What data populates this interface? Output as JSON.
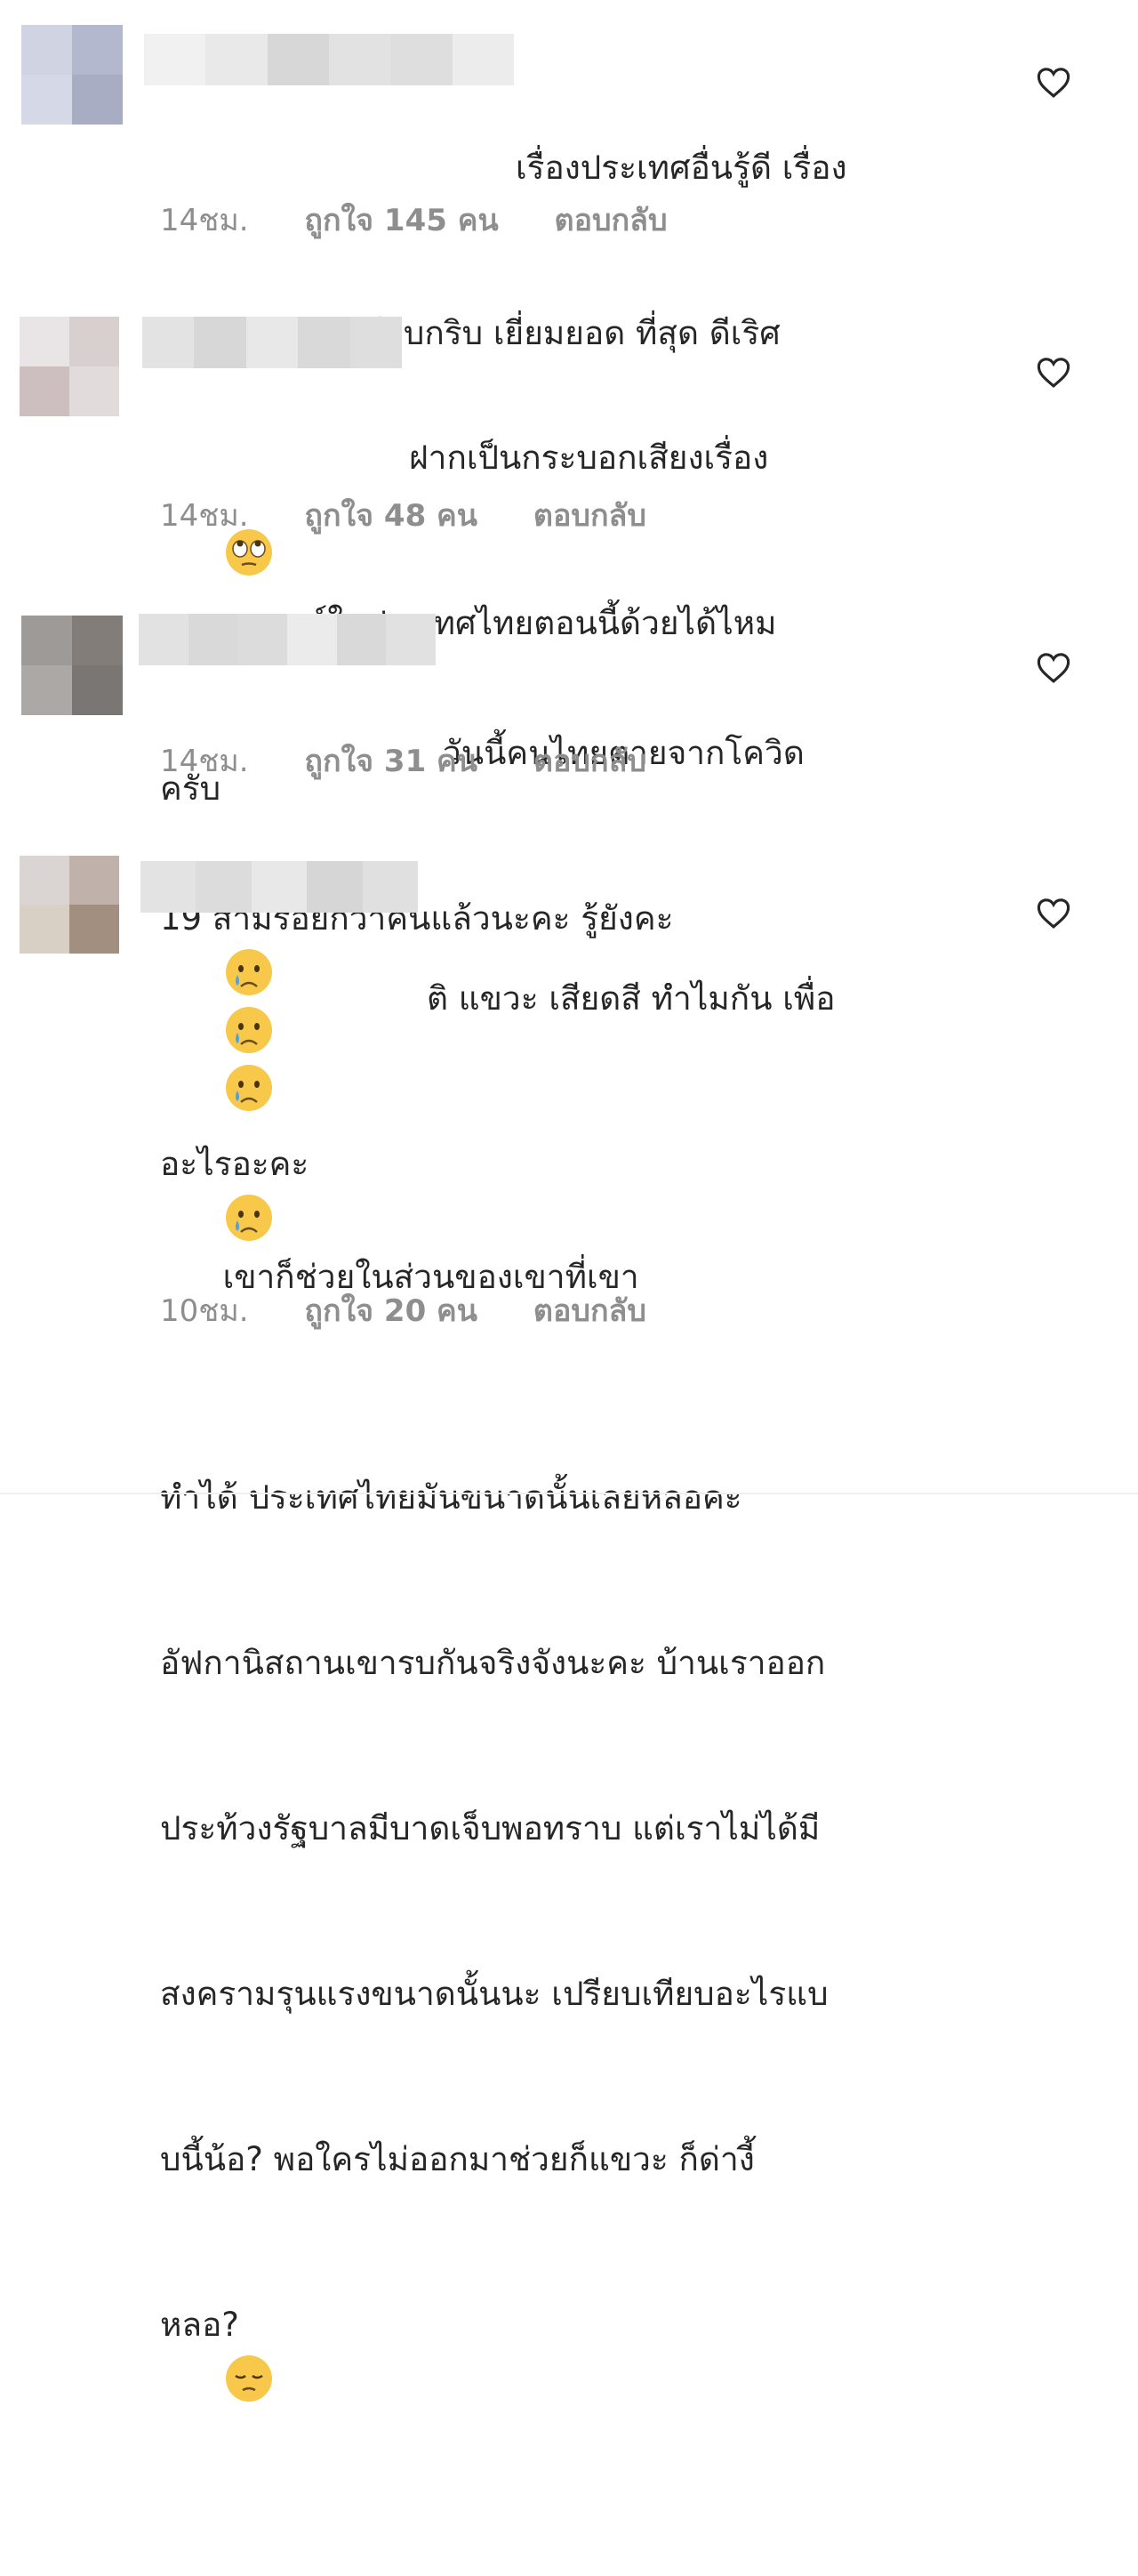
{
  "comments": [
    {
      "text_lines": [
        "เรื่องประเทศอื่นรู้ดี เรื่อง",
        "ประเทศตัวเองเงียบกริบ เยี่ยมยอด ที่สุด ดีเริศ"
      ],
      "emoji": "rolling-eyes",
      "time": "14ชม.",
      "likes": "ถูกใจ 145 คน",
      "reply": "ตอบกลับ",
      "avatar_colors": [
        "#cfd3e2",
        "#b3b8cf",
        "#d5d8e6",
        "#a9adc3"
      ]
    },
    {
      "text_lines": [
        "ฝากเป็นกระบอกเสียงเรื่อง",
        "สถานการณ์ในประเทศไทยตอนนี้ด้วยได้ไหม",
        "ครับ"
      ],
      "time": "14ชม.",
      "likes": "ถูกใจ 48 คน",
      "reply": "ตอบกลับ",
      "avatar_colors": [
        "#e9e4e5",
        "#d8d0cf",
        "#cdbfbf",
        "#e1dcdb"
      ]
    },
    {
      "text_lines": [
        "วันนี้คนไทยตายจากโควิด",
        "19 สามร้อยกว่าคนแล้วนะคะ รู้ยังคะ"
      ],
      "emoji": "crying",
      "time": "14ชม.",
      "likes": "ถูกใจ 31 คน",
      "reply": "ตอบกลับ",
      "avatar_colors": [
        "#9d9a98",
        "#837d79",
        "#aba8a6",
        "#7a7674"
      ]
    },
    {
      "text_lines": [
        "ติ แขวะ เสียดสี ทำไมกัน เพื่อ",
        "อะไรอะคะ",
        "เขาก็ช่วยในส่วนของเขาที่เขา",
        "ทำได้ ประเทศไทยมันขนาดนั้นเลยหลอคะ",
        "อัฟกานิสถานเขารบกันจริงจังนะคะ บ้านเราออก",
        "ประท้วงรัฐบาลมีบาดเจ็บพอทราบ แต่เราไม่ได้มี",
        "สงครามรุนแรงขนาดนั้นนะ เปรียบเทียบอะไรแบ",
        "บนี้น้อ? พอใครไม่ออกมาช่วยก็แขวะ ก็ด่างี้",
        "หลอ?"
      ],
      "emoji": "crying",
      "emoji_end": "pensive",
      "time": "10ชม.",
      "likes": "ถูกใจ 20 คน",
      "reply": "ตอบกลับ",
      "avatar_colors": [
        "#dad5d3",
        "#c0b2ab",
        "#d8cfc5",
        "#a38f80"
      ]
    }
  ],
  "icons": {
    "like": "heart-icon"
  },
  "colors": {
    "text": "#262626",
    "meta": "#8e8e8e",
    "emoji_face": "#f7c84a"
  }
}
